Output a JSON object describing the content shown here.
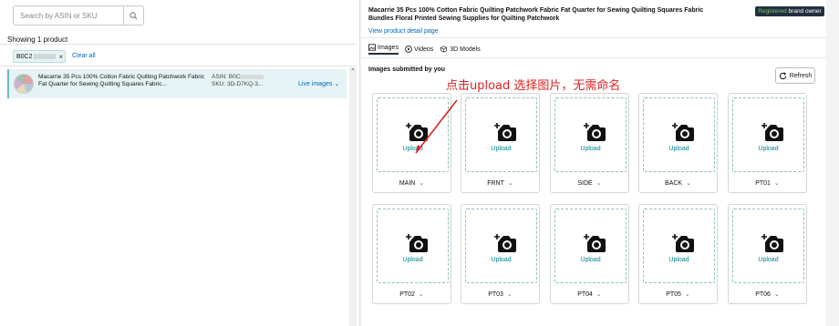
{
  "left": {
    "search_placeholder": "Search by ASIN or SKU",
    "showing": "Showing 1 product",
    "chip_code": "B0C2",
    "chip_close": "×",
    "clear_all": "Clear all",
    "product": {
      "title": "Macarrie 35 Pcs 100% Cotton Fabric Quilting Patchwork Fabric Fat Quarter for Sewing Quilting Squares Fabric...",
      "asin_label": "ASIN: B0C",
      "sku_label": "SKU: 3D-D7KQ-3...",
      "live_images": "Live images"
    }
  },
  "right": {
    "title": "Macarrie 35 Pcs 100% Cotton Fabric Quilting Patchwork Fabric Fat Quarter for Sewing Quilting Squares Fabric Bundles Floral Printed Sewing Supplies for Quilting Patchwork",
    "view_link": "View product detail page",
    "badge_reg": "Registered",
    "badge_rest": "brand owner",
    "tabs": [
      {
        "label": "Images",
        "icon": "image-icon"
      },
      {
        "label": "Videos",
        "icon": "play-icon"
      },
      {
        "label": "3D Models",
        "icon": "cube-icon"
      }
    ],
    "submitted": "Images submitted by you",
    "annotation": "点击upload 选择图片，无需命名",
    "refresh": "Refresh",
    "upload_label": "Upload",
    "slots": [
      "MAIN",
      "FRNT",
      "SIDE",
      "BACK",
      "PT01",
      "PT02",
      "PT03",
      "PT04",
      "PT05",
      "PT06"
    ]
  },
  "colors": {
    "link": "#0066c0",
    "teal": "#00838f",
    "annotation": "#e02020",
    "badge_bg": "#232f3e"
  }
}
